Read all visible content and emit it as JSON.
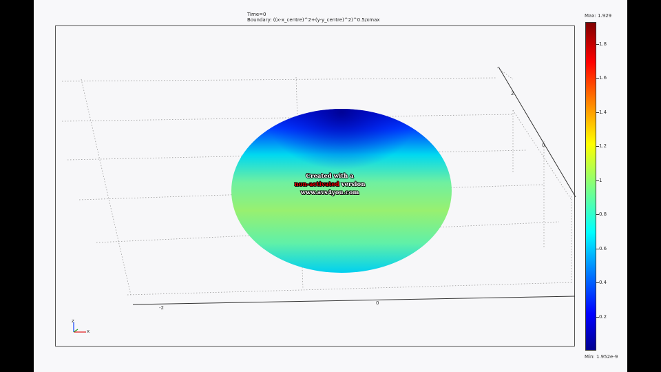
{
  "header": {
    "time_line": "Time=0",
    "boundary_line": "Boundary: ((x-x_centre)^2+(y-y_centre)^2)^0.5/xmax"
  },
  "legend": {
    "max_label": "Max: 1.929",
    "min_label": "Min: 1.952e-9",
    "ticks": [
      "1.8",
      "1.6",
      "1.4",
      "1.2",
      "1",
      "0.8",
      "0.6",
      "0.4",
      "0.2"
    ]
  },
  "axes": {
    "x_tick_neg2": "-2",
    "x_tick_0": "0",
    "y_tick_2": "2",
    "y_tick_0": "0",
    "triad_z": "z",
    "triad_x": "x",
    "triad_y": "y"
  },
  "watermark": {
    "line1": "Created with a",
    "line2_red": "non-activated",
    "line2_rest": " version",
    "line3": "www.avs4you.com"
  },
  "colors": {
    "frame_background": "#f8f8fa",
    "outer_background": "#000000",
    "surface_top": "#0010d0",
    "surface_mid": "#00e0e0",
    "surface_low": "#90f070"
  }
}
